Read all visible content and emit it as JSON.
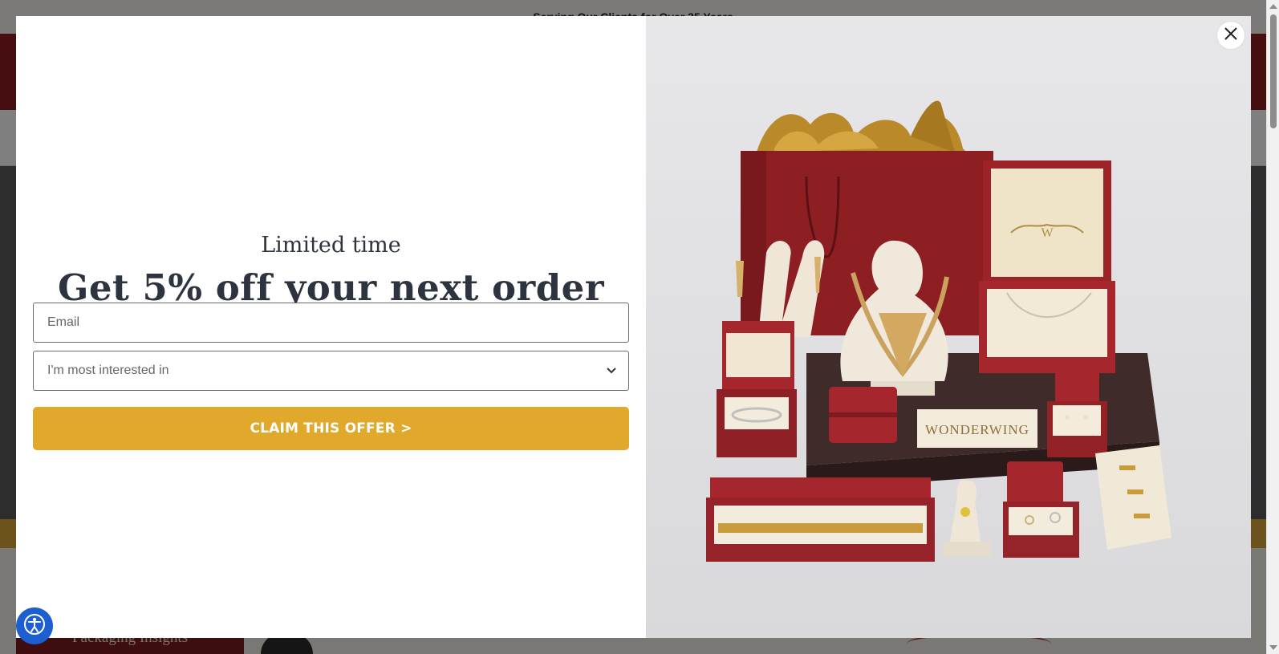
{
  "background": {
    "announcement": "Serving Our Clients for Over 35 Years",
    "insights_label": "Packaging Insights"
  },
  "modal": {
    "eyebrow": "Limited time",
    "headline": "Get 5% off your next order",
    "email_placeholder": "Email",
    "interest_selected": "I'm most interested in",
    "cta_label": "CLAIM THIS OFFER >",
    "photo_brand_text": "WONDERWING",
    "photo_box_monogram": "W"
  },
  "icons": {
    "close": "close-icon",
    "chevron": "chevron-down-icon",
    "accessibility": "accessibility-icon"
  },
  "colors": {
    "cta": "#e1a92b",
    "header_brand": "#8e1c22",
    "text_dark": "#2e3340",
    "accessibility": "#1d5fd1"
  }
}
